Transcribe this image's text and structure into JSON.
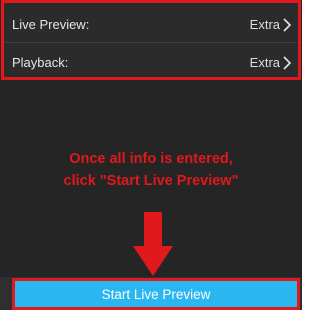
{
  "settings": {
    "rows": [
      {
        "label": "Live Preview:",
        "value": "Extra"
      },
      {
        "label": "Playback:",
        "value": "Extra"
      }
    ]
  },
  "annotation": {
    "line1": "Once all info is entered,",
    "line2": "click \"Start Live Preview\""
  },
  "button": {
    "label": "Start Live Preview"
  },
  "colors": {
    "background": "#252525",
    "highlight": "#e0191c",
    "accent": "#2ab6f0"
  }
}
